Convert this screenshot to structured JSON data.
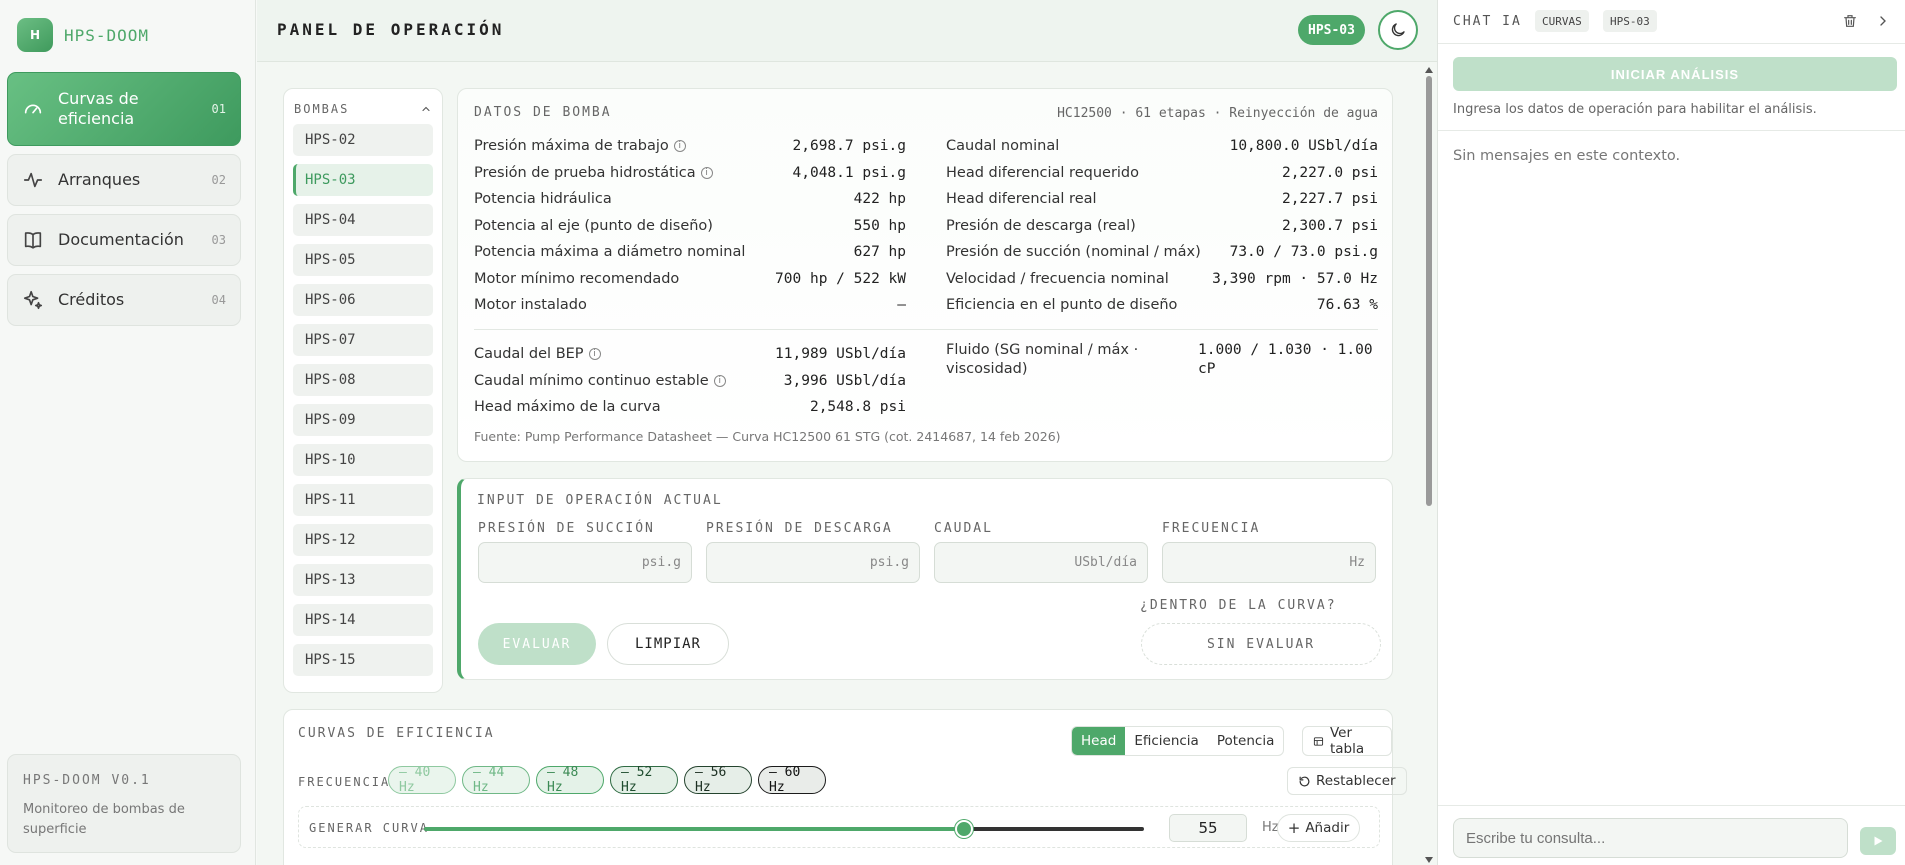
{
  "brand": {
    "logo_letter": "H",
    "name": "HPS-DOOM"
  },
  "nav": [
    {
      "label": "Curvas de eficiencia",
      "num": "01",
      "icon": "gauge-icon"
    },
    {
      "label": "Arranques",
      "num": "02",
      "icon": "activity-icon"
    },
    {
      "label": "Documentación",
      "num": "03",
      "icon": "book-icon"
    },
    {
      "label": "Créditos",
      "num": "04",
      "icon": "sparkles-icon"
    }
  ],
  "footer": {
    "title": "HPS-DOOM V0.1",
    "desc": "Monitoreo de bombas de superficie"
  },
  "header": {
    "title": "PANEL DE OPERACIÓN",
    "badge": "HPS-03"
  },
  "pumps": {
    "title": "BOMBAS",
    "items": [
      "HPS-02",
      "HPS-03",
      "HPS-04",
      "HPS-05",
      "HPS-06",
      "HPS-07",
      "HPS-08",
      "HPS-09",
      "HPS-10",
      "HPS-11",
      "HPS-12",
      "HPS-13",
      "HPS-14",
      "HPS-15"
    ],
    "selected": "HPS-03"
  },
  "datos": {
    "title": "DATOS DE BOMBA",
    "subtitle": "HC12500 · 61 etapas · Reinyección de agua",
    "left": [
      {
        "label": "Presión máxima de trabajo",
        "value": "2,698.7 psi.g",
        "info": true
      },
      {
        "label": "Presión de prueba hidrostática",
        "value": "4,048.1 psi.g",
        "info": true
      },
      {
        "label": "Potencia hidráulica",
        "value": "422 hp",
        "info": false
      },
      {
        "label": "Potencia al eje (punto de diseño)",
        "value": "550 hp",
        "info": false
      },
      {
        "label": "Potencia máxima a diámetro nominal",
        "value": "627 hp",
        "info": false
      },
      {
        "label": "Motor mínimo recomendado",
        "value": "700 hp / 522 kW",
        "info": false
      },
      {
        "label": "Motor instalado",
        "value": "—",
        "info": false
      }
    ],
    "right": [
      {
        "label": "Caudal nominal",
        "value": "10,800.0 USbl/día"
      },
      {
        "label": "Head diferencial requerido",
        "value": "2,227.0 psi"
      },
      {
        "label": "Head diferencial real",
        "value": "2,227.7 psi"
      },
      {
        "label": "Presión de descarga (real)",
        "value": "2,300.7 psi"
      },
      {
        "label": "Presión de succión (nominal / máx)",
        "value": "73.0 / 73.0 psi.g"
      },
      {
        "label": "Velocidad / frecuencia nominal",
        "value": "3,390 rpm · 57.0 Hz"
      },
      {
        "label": "Eficiencia en el punto de diseño",
        "value": "76.63 %"
      }
    ],
    "left2": [
      {
        "label": "Caudal del BEP",
        "value": "11,989 USbl/día",
        "info": true
      },
      {
        "label": "Caudal mínimo continuo estable",
        "value": "3,996 USbl/día",
        "info": true
      },
      {
        "label": "Head máximo de la curva",
        "value": "2,548.8 psi",
        "info": false
      }
    ],
    "fluid": {
      "label": "Fluido (SG nominal / máx · viscosidad)",
      "value": "1.000 / 1.030 · 1.00 cP"
    },
    "fuente": "Fuente: Pump Performance Datasheet — Curva HC12500 61 STG (cot. 2414687, 14 feb 2026)"
  },
  "input": {
    "title": "INPUT DE OPERACIÓN ACTUAL",
    "fields": [
      {
        "label": "PRESIÓN DE SUCCIÓN",
        "unit": "psi.g",
        "value": ""
      },
      {
        "label": "PRESIÓN DE DESCARGA",
        "unit": "psi.g",
        "value": ""
      },
      {
        "label": "CAUDAL",
        "unit": "USbl/día",
        "value": ""
      },
      {
        "label": "FRECUENCIA",
        "unit": "Hz",
        "value": ""
      }
    ],
    "evaluate": "EVALUAR",
    "clear": "LIMPIAR",
    "inside_label": "¿DENTRO DE LA CURVA?",
    "inside_status": "SIN EVALUAR"
  },
  "curvas": {
    "title": "CURVAS DE EFICIENCIA",
    "tabs": [
      "Head",
      "Eficiencia",
      "Potencia"
    ],
    "active_tab": "Head",
    "ver_tabla": "Ver tabla",
    "freq_label": "FRECUENCIAS",
    "frequencies": [
      {
        "label": "— 40 Hz",
        "color": "#8fc9a0",
        "text": "#8fc9a0",
        "bg": "#eaf5ed"
      },
      {
        "label": "— 44 Hz",
        "color": "#6fb886",
        "text": "#6fb886",
        "bg": "#eaf5ed"
      },
      {
        "label": "— 48 Hz",
        "color": "#4ea86a",
        "text": "#3c8a55",
        "bg": "#e4f2e8"
      },
      {
        "label": "— 52 Hz",
        "color": "#2f6b43",
        "text": "#1f4d2f",
        "bg": "#e4f0e7"
      },
      {
        "label": "— 56 Hz",
        "color": "#24432e",
        "text": "#1b2e21",
        "bg": "#e6eee8"
      },
      {
        "label": "— 60 Hz",
        "color": "#1b1b1b",
        "text": "#111111",
        "bg": "#e9ece9"
      }
    ],
    "reset": "Restablecer",
    "gen_label": "GENERAR CURVA",
    "slider": {
      "min": 40,
      "max": 60,
      "value": 55
    },
    "hz_value": "55",
    "hz_unit": "Hz",
    "add": "Añadir"
  },
  "chat": {
    "title": "CHAT IA",
    "tags": [
      "CURVAS",
      "HPS-03"
    ],
    "start": "INICIAR ANÁLISIS",
    "hint": "Ingresa los datos de operación para habilitar el análisis.",
    "empty": "Sin mensajes en este contexto.",
    "placeholder": "Escribe tu consulta..."
  },
  "colors": {
    "accent": "#4ea86a",
    "accent_light": "#bfe0c9"
  }
}
